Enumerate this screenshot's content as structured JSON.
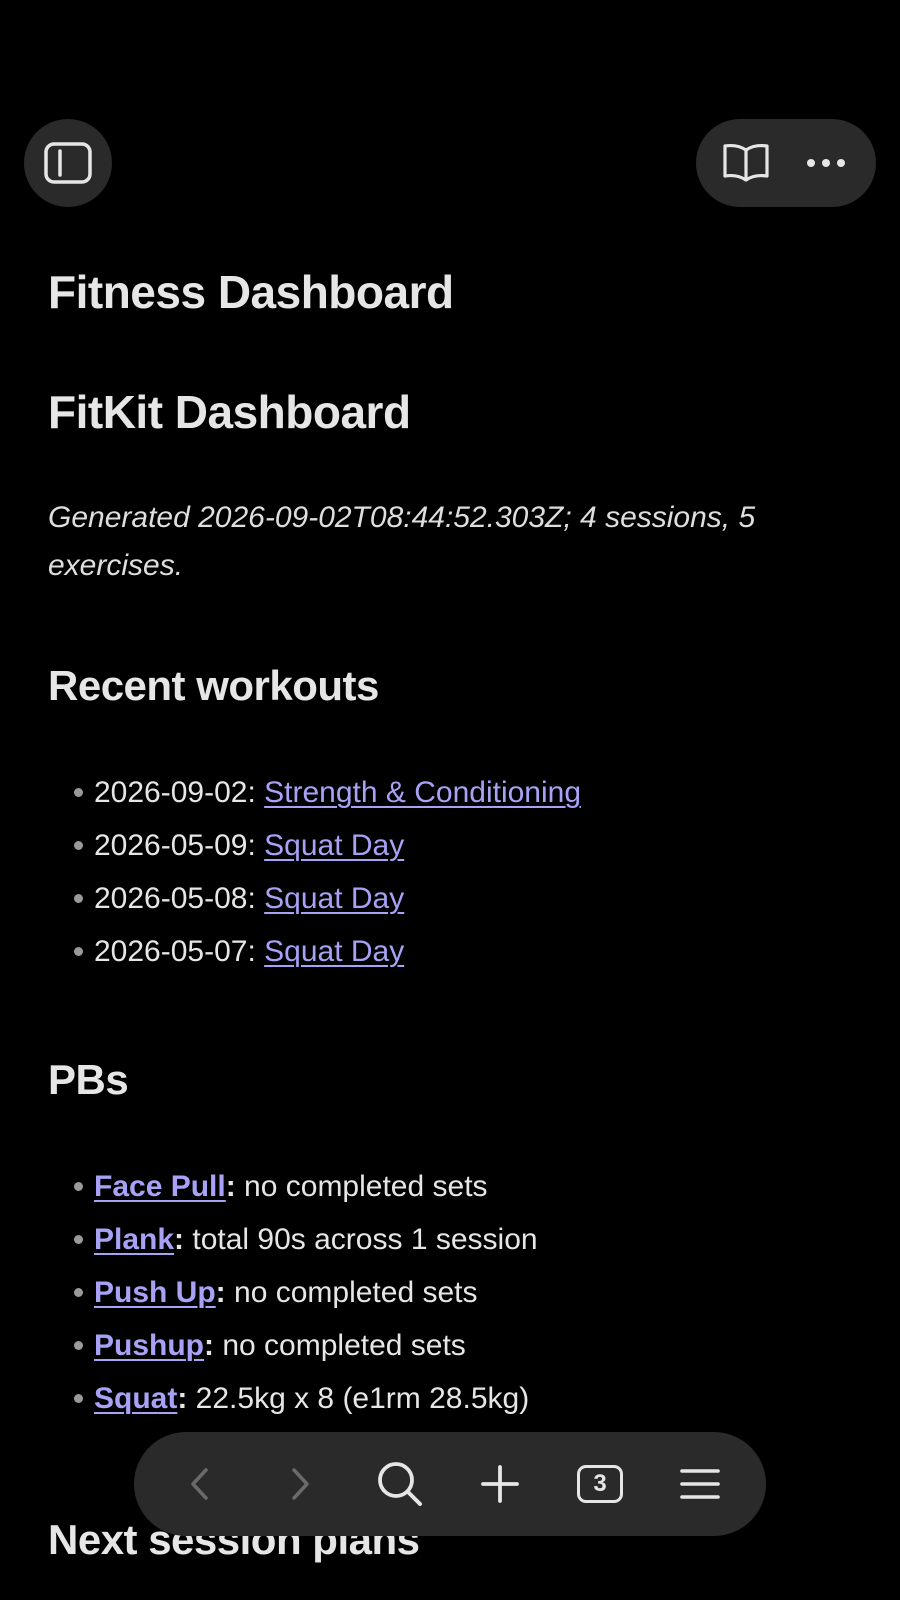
{
  "toolbar_top": {
    "sidebar_icon": "sidebar-icon",
    "reader_icon": "book-icon",
    "more_icon": "ellipsis-icon"
  },
  "page": {
    "title": "Fitness Dashboard",
    "heading": "FitKit Dashboard",
    "generated": "Generated 2026-09-02T08:44:52.303Z; 4 sessions, 5 exercises."
  },
  "recent": {
    "heading": "Recent workouts",
    "items": [
      {
        "date": "2026-09-02: ",
        "link": "Strength & Conditioning"
      },
      {
        "date": "2026-05-09: ",
        "link": "Squat Day"
      },
      {
        "date": "2026-05-08: ",
        "link": "Squat Day"
      },
      {
        "date": "2026-05-07: ",
        "link": "Squat Day"
      }
    ]
  },
  "pbs": {
    "heading": "PBs",
    "items": [
      {
        "name": "Face Pull",
        "colon": ":",
        "detail": " no completed sets"
      },
      {
        "name": "Plank",
        "colon": ":",
        "detail": " total 90s across 1 session"
      },
      {
        "name": "Push Up",
        "colon": ":",
        "detail": " no completed sets"
      },
      {
        "name": "Pushup",
        "colon": ":",
        "detail": " no completed sets"
      },
      {
        "name": "Squat",
        "colon": ":",
        "detail": " 22.5kg x 8 (e1rm 28.5kg)"
      }
    ]
  },
  "next": {
    "heading": "Next session plans"
  },
  "bottom_toolbar": {
    "tab_count": "3",
    "icons": [
      "back-icon",
      "forward-icon",
      "search-icon",
      "plus-icon",
      "tabs-icon",
      "menu-icon"
    ]
  },
  "colors": {
    "background": "#000000",
    "text": "#e6e6e6",
    "link": "#a7a2f5",
    "pill": "#2a2a2a"
  }
}
